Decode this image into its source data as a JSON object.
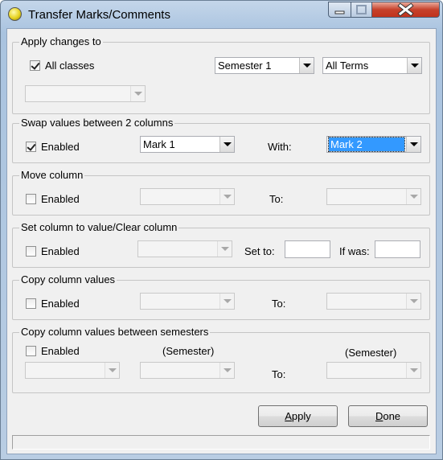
{
  "window": {
    "title": "Transfer Marks/Comments"
  },
  "apply_changes": {
    "legend": "Apply changes to",
    "all_classes_label": "All classes",
    "all_classes_checked": true,
    "semester": "Semester 1",
    "terms": "All Terms",
    "class_select": ""
  },
  "swap": {
    "legend": "Swap values between 2 columns",
    "enabled_label": "Enabled",
    "enabled_checked": true,
    "column_a": "Mark 1",
    "with_label": "With:",
    "column_b": "Mark 2"
  },
  "move": {
    "legend": "Move column",
    "enabled_label": "Enabled",
    "to_label": "To:"
  },
  "set_column": {
    "legend": "Set column to value/Clear column",
    "enabled_label": "Enabled",
    "set_to_label": "Set to:",
    "if_was_label": "If was:",
    "set_to_value": "",
    "if_was_value": ""
  },
  "copy": {
    "legend": "Copy column values",
    "enabled_label": "Enabled",
    "to_label": "To:"
  },
  "copy_semesters": {
    "legend": "Copy column values between semesters",
    "enabled_label": "Enabled",
    "semester_label_1": "(Semester)",
    "semester_label_2": "(Semester)",
    "to_label": "To:"
  },
  "buttons": {
    "apply_label": "Apply",
    "apply_mnemonic": "A",
    "apply_rest": "pply",
    "done_label": "Done",
    "done_mnemonic": "D",
    "done_rest": "one"
  },
  "status": {
    "text": ""
  }
}
